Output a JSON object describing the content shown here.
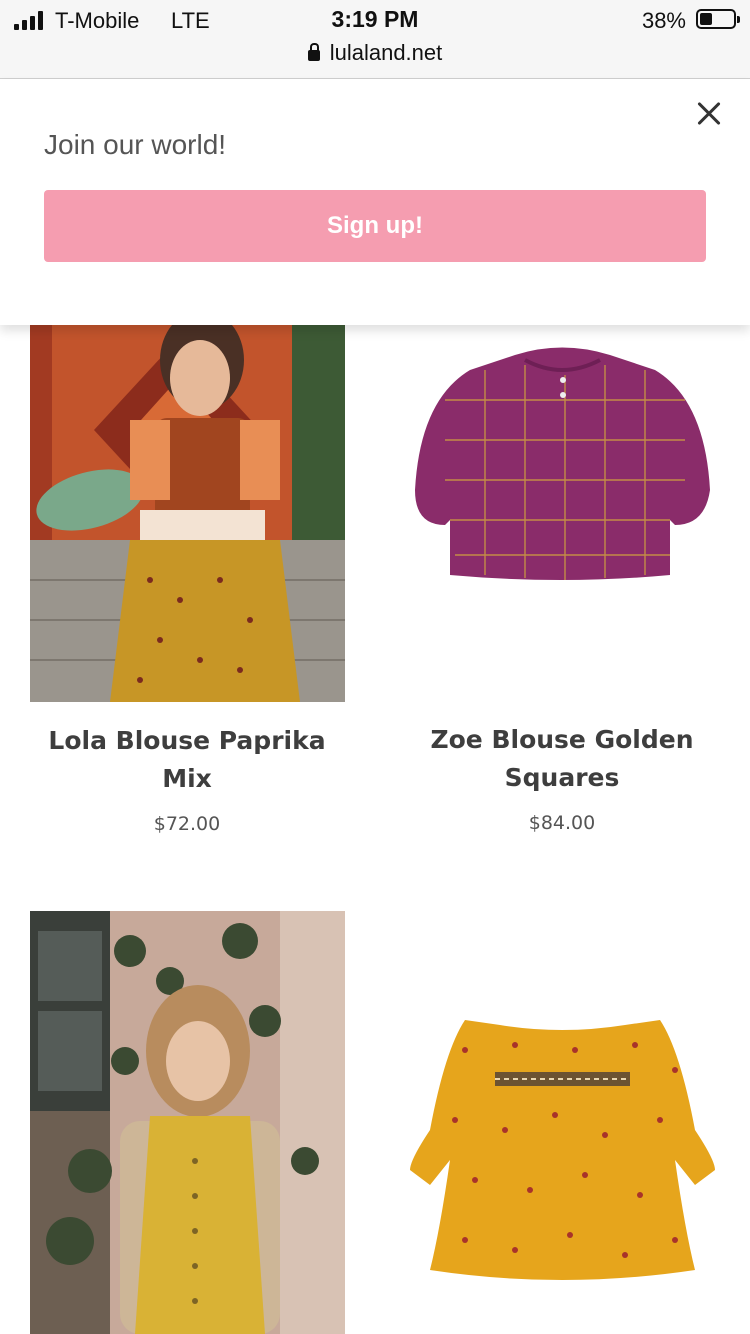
{
  "status_bar": {
    "carrier": "T-Mobile",
    "network": "LTE",
    "time": "3:19 PM",
    "battery_percent": "38%",
    "battery_level": 0.38,
    "url": "lulaland.net"
  },
  "popup": {
    "title": "Join our world!",
    "signup_label": "Sign up!",
    "button_color": "#f59db0"
  },
  "products": [
    {
      "name": "Lola Blouse Paprika Mix",
      "price": "$72.00"
    },
    {
      "name": "Zoe Blouse Golden Squares",
      "price": "$84.00"
    }
  ],
  "icons": [
    "signal-icon",
    "lock-icon",
    "battery-icon",
    "close-icon"
  ]
}
